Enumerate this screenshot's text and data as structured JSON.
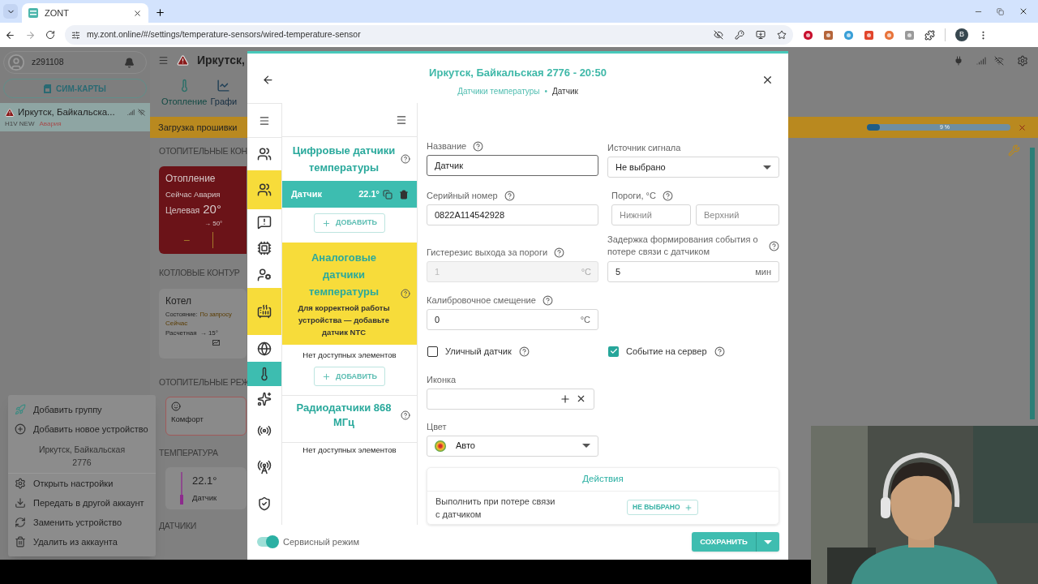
{
  "browser": {
    "tab_title": "ZONT",
    "url": "my.zont.online/#/settings/temperature-sensors/wired-temperature-sensor",
    "profile_initial": "B"
  },
  "sidebar": {
    "user": "z291108",
    "sim_button": "СИМ-КАРТЫ",
    "devices": [
      {
        "name": "Иркутск, Байкальска...",
        "model": "H1V NEW",
        "status": "Авария",
        "selected": true
      }
    ]
  },
  "header": {
    "title": "Иркутск,"
  },
  "tabs": [
    {
      "label": "Отопление",
      "selected": true
    },
    {
      "label": "Графи",
      "selected": false
    }
  ],
  "firmware_bar": {
    "label": "Загрузка прошивки",
    "level": 0.09,
    "reading": "9 %"
  },
  "dashboard": {
    "heating_heading": "ОТОПИТЕЛЬНЫЕ КОН",
    "heating_card": {
      "title": "Отопление",
      "state": "Сейчас Авария",
      "target_label": "Целевая",
      "target": "20°",
      "setpoint": "→ 50°",
      "minus": "−"
    },
    "boiler_heading": "КОТЛОВЫЕ КОНТУР",
    "boiler_card": {
      "title": "Котел",
      "state_label": "Состояние:",
      "state": "По запросу",
      "now": "Сейчас",
      "calc_label": "Расчетная",
      "calc": "→ 15°"
    },
    "modes_heading": "ОТОПИТЕЛЬНЫЕ РЕЖ",
    "mode_card": {
      "label": "Комфорт"
    },
    "temperature_heading": "ТЕМПЕРАТУРА",
    "temperature_card": {
      "value": "22.1°",
      "label": "Датчик"
    },
    "sensors_heading": "ДАТЧИКИ"
  },
  "context_menu": {
    "items": [
      {
        "kind": "item",
        "label": "Добавить группу"
      },
      {
        "kind": "item",
        "label": "Добавить новое устройство"
      },
      {
        "kind": "heading",
        "label": "Иркутск, Байкальская 2776"
      },
      {
        "kind": "item",
        "label": "Открыть настройки"
      },
      {
        "kind": "item",
        "label": "Передать в другой аккаунт"
      },
      {
        "kind": "item",
        "label": "Заменить устройство"
      },
      {
        "kind": "item",
        "label": "Удалить из аккаунта"
      }
    ]
  },
  "modal": {
    "title": "Иркутск, Байкальская 2776 - 20:50",
    "breadcrumb": {
      "link": "Датчики температуры",
      "separator": "•",
      "current": "Датчик"
    },
    "rail": [
      {
        "selected": false,
        "attention": false
      },
      {
        "selected": false,
        "attention": true
      },
      {
        "selected": false,
        "attention": false
      },
      {
        "selected": false,
        "attention": false
      },
      {
        "selected": false,
        "attention": false
      },
      {
        "selected": false,
        "attention": true
      },
      {
        "selected": false,
        "attention": false
      },
      {
        "selected": true,
        "attention": false
      },
      {
        "selected": false,
        "attention": false
      },
      {
        "selected": false,
        "attention": false
      },
      {
        "selected": false,
        "attention": false
      },
      {
        "selected": false,
        "attention": false
      }
    ],
    "sections": [
      {
        "title": "Цифровые датчики температуры",
        "attention": false,
        "items": [
          {
            "name": "Датчик",
            "value": "22.1°",
            "selected": true
          }
        ],
        "add_button": "ДОБАВИТЬ"
      },
      {
        "title": "Аналоговые датчики температуры",
        "attention": true,
        "note": "Для корректной работы устройства — добавьте датчик NTC",
        "empty": "Нет доступных элементов",
        "add_button": "ДОБАВИТЬ"
      },
      {
        "title": "Радиодатчики 868 МГц",
        "attention": false,
        "empty": "Нет доступных элементов"
      }
    ],
    "form": {
      "name": {
        "label": "Название",
        "help": true,
        "value": "Датчик",
        "focused": true
      },
      "source": {
        "label": "Источник сигнала",
        "value": "Не выбрано"
      },
      "serial": {
        "label": "Серийный номер",
        "help": true,
        "value": "0822A114542928"
      },
      "thresholds": {
        "label": "Пороги, °C",
        "help": true,
        "fields": [
          {
            "placeholder": "Нижний"
          },
          {
            "placeholder": "Верхний"
          }
        ]
      },
      "hysteresis": {
        "label": "Гистерезис выхода за пороги",
        "help": true,
        "placeholder": "1",
        "unit": "°C",
        "disabled": true
      },
      "delay": {
        "label": "Задержка формирования события о потере связи с датчиком",
        "help": true,
        "value": "5",
        "unit": "мин",
        "disabled": false
      },
      "calibration": {
        "label": "Калибровочное смещение",
        "help": true,
        "value": "0",
        "unit": "°C",
        "disabled": false
      },
      "outdoor": {
        "label": "Уличный датчик",
        "help": true,
        "checked": false
      },
      "server_event": {
        "label": "Событие на сервер",
        "help": true,
        "checked": true
      },
      "icon": {
        "label": "Иконка"
      },
      "color": {
        "label": "Цвет",
        "value": "Авто"
      },
      "actions": {
        "title": "Действия",
        "rows": [
          {
            "label": "Выполнить при потере связи с датчиком",
            "button": "НЕ ВЫБРАНО"
          }
        ]
      }
    },
    "service_mode": {
      "label": "Сервисный режим",
      "on": true
    },
    "save_button": "СОХРАНИТЬ"
  }
}
